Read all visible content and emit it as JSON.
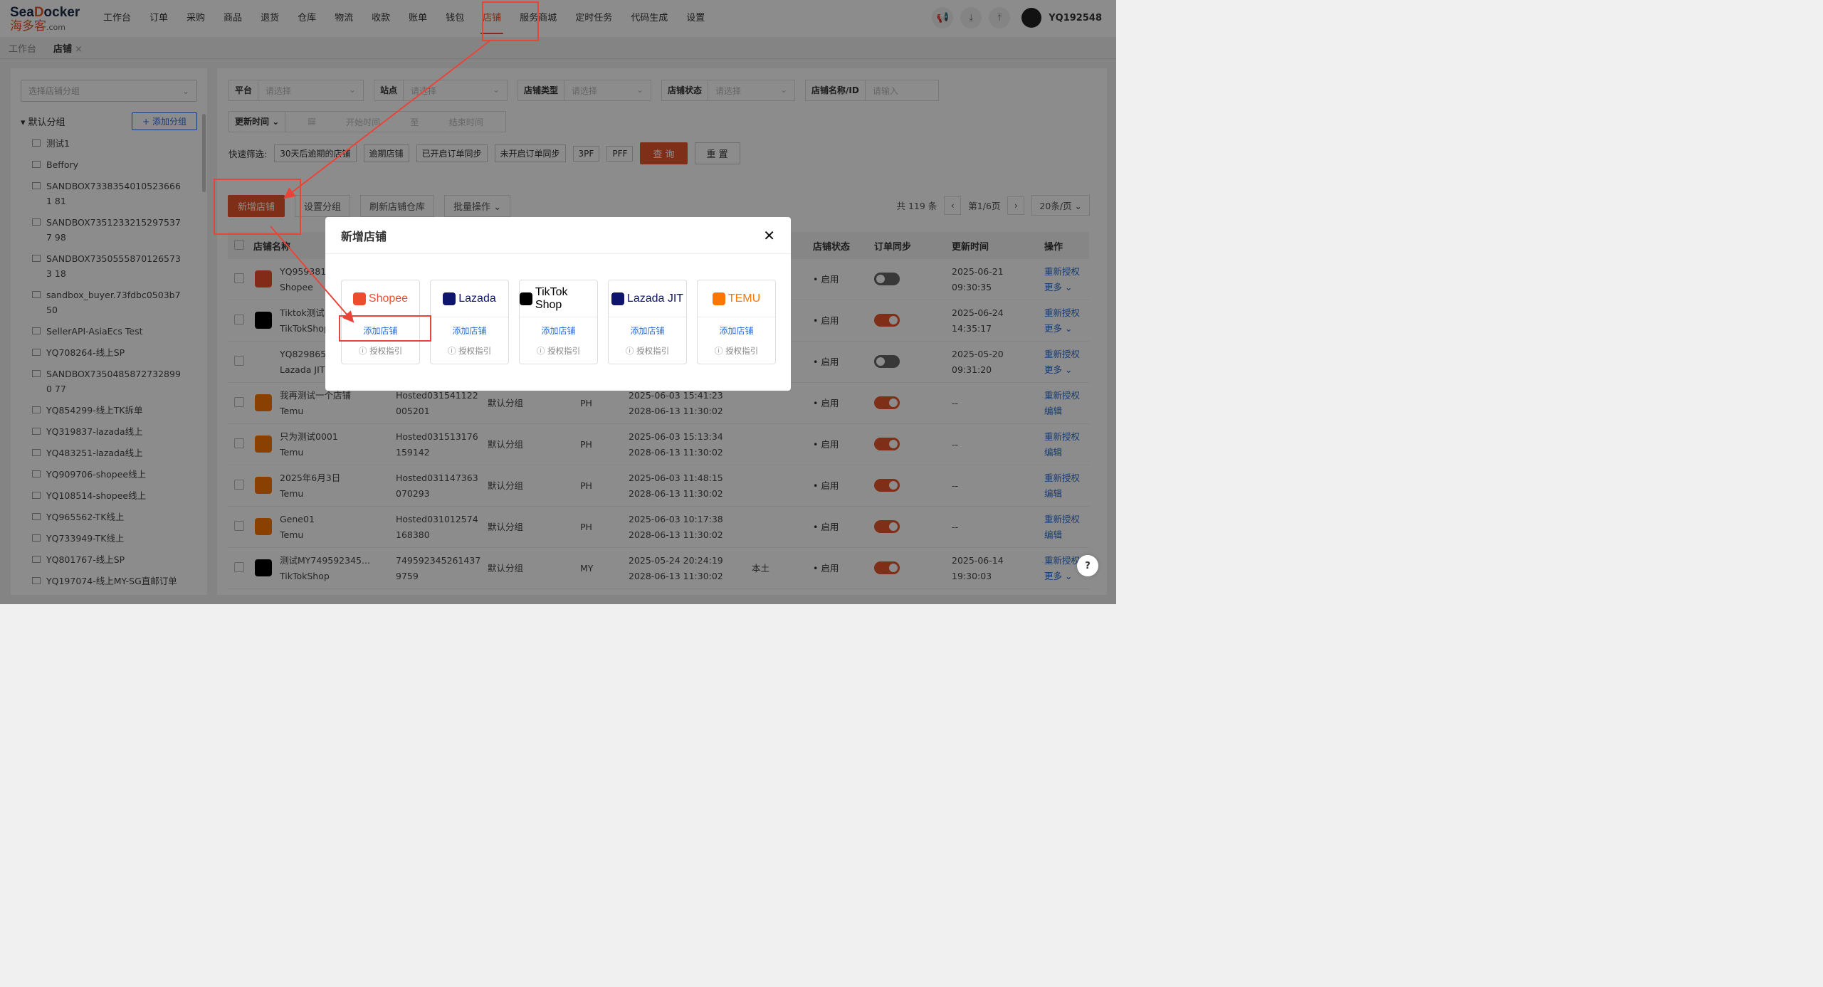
{
  "logo": {
    "en_a": "Sea",
    "en_b": "D",
    "en_c": "ocker",
    "cn": "海多客",
    "suffix": ".com"
  },
  "nav": [
    "工作台",
    "订单",
    "采购",
    "商品",
    "退货",
    "仓库",
    "物流",
    "收款",
    "账单",
    "钱包",
    "店铺",
    "服务商城",
    "定时任务",
    "代码生成",
    "设置"
  ],
  "nav_active": "店铺",
  "username": "YQ192548",
  "tabs": {
    "t1": "工作台",
    "t2": "店铺"
  },
  "sidebar": {
    "select": "选择店铺分组",
    "group": "默认分组",
    "add": "+ 添加分组",
    "items": [
      "测试1",
      "Beffory",
      "SANDBOX73383540105236661 81",
      "SANDBOX73512332152975377 98",
      "SANDBOX73505558701265733 18",
      "sandbox_buyer.73fdbc0503b750",
      "SellerAPI-AsiaEcs Test",
      "YQ708264-线上SP",
      "SANDBOX73504858727328990 77",
      "YQ854299-线上TK拆单",
      "YQ319837-lazada线上",
      "YQ483251-lazada线上",
      "YQ909706-shopee线上",
      "YQ108514-shopee线上",
      "YQ965562-TK线上",
      "YQ733949-TK线上",
      "YQ801767-线上SP",
      "YQ197074-线上MY-SG直邮订单"
    ]
  },
  "filters": {
    "platform": "平台",
    "site": "站点",
    "type": "店铺类型",
    "status": "店铺状态",
    "name": "店铺名称/ID",
    "ph": "请选择",
    "ph_in": "请输入",
    "time": "更新时间",
    "start": "开始时间",
    "to": "至",
    "end": "结束时间",
    "quick": "快速筛选:",
    "chips": [
      "30天后逾期的店铺",
      "逾期店铺",
      "已开启订单同步",
      "未开启订单同步",
      "3PF",
      "PFF"
    ],
    "query": "查 询",
    "reset": "重 置"
  },
  "actions": {
    "add": "新增店铺",
    "group": "设置分组",
    "refresh": "刷新店铺仓库",
    "batch": "批量操作"
  },
  "pager": {
    "total": "共 119 条",
    "page": "第1/6页",
    "size": "20条/页"
  },
  "thead": {
    "name": "店铺名称",
    "status": "店铺状态",
    "sync": "订单同步",
    "updated": "更新时间",
    "op": "操作"
  },
  "rows": [
    {
      "n1": "YQ959381-",
      "n2": "Shopee",
      "st": "启用",
      "sync": "off",
      "u1": "2025-06-21",
      "u2": "09:30:35",
      "o1": "重新授权",
      "o2": "更多 ⌄"
    },
    {
      "n1": "Tiktok测试(",
      "n2": "TikTokShop",
      "st": "启用",
      "sync": "on",
      "u1": "2025-06-24",
      "u2": "14:35:17",
      "o1": "重新授权",
      "o2": "更多 ⌄"
    },
    {
      "n1": "YQ829865-",
      "n2": "Lazada JIT",
      "st": "启用",
      "sync": "off",
      "u1": "2025-05-20",
      "u2": "09:31:20",
      "o1": "重新授权",
      "o2": "更多 ⌄"
    },
    {
      "n1": "我再测试一个店铺",
      "n2": "Temu",
      "id1": "Hosted031541122",
      "id2": "005201",
      "g": "默认分组",
      "site": "PH",
      "t1": "2025-06-03 15:41:23",
      "t2": "2028-06-13 11:30:02",
      "st": "启用",
      "sync": "on",
      "u1": "--",
      "o1": "重新授权",
      "o2": "编辑"
    },
    {
      "n1": "只为测试0001",
      "n2": "Temu",
      "id1": "Hosted031513176",
      "id2": "159142",
      "g": "默认分组",
      "site": "PH",
      "t1": "2025-06-03 15:13:34",
      "t2": "2028-06-13 11:30:02",
      "st": "启用",
      "sync": "on",
      "u1": "--",
      "o1": "重新授权",
      "o2": "编辑"
    },
    {
      "n1": "2025年6月3日",
      "n2": "Temu",
      "id1": "Hosted031147363",
      "id2": "070293",
      "g": "默认分组",
      "site": "PH",
      "t1": "2025-06-03 11:48:15",
      "t2": "2028-06-13 11:30:02",
      "st": "启用",
      "sync": "on",
      "u1": "--",
      "o1": "重新授权",
      "o2": "编辑"
    },
    {
      "n1": "Gene01",
      "n2": "Temu",
      "id1": "Hosted031012574",
      "id2": "168380",
      "g": "默认分组",
      "site": "PH",
      "t1": "2025-06-03 10:17:38",
      "t2": "2028-06-13 11:30:02",
      "st": "启用",
      "sync": "on",
      "u1": "--",
      "o1": "重新授权",
      "o2": "编辑"
    },
    {
      "n1": "测试MY749592345...",
      "n2": "TikTokShop",
      "id1": "749592345261437",
      "id2": "9759",
      "g": "默认分组",
      "site": "MY",
      "type": "本土",
      "t1": "2025-05-24 20:24:19",
      "t2": "2028-06-13 11:30:02",
      "st": "启用",
      "sync": "on",
      "u1": "2025-06-14",
      "u2": "19:30:03",
      "o1": "重新授权",
      "o2": "更多 ⌄"
    }
  ],
  "modal": {
    "title": "新增店铺",
    "close": "✕",
    "add": "添加店铺",
    "guide": "授权指引",
    "platforms": [
      {
        "name": "Shopee",
        "color": "#ee4d2d"
      },
      {
        "name": "Lazada",
        "color": "#0f146d"
      },
      {
        "name": "TikTok Shop",
        "color": "#000000"
      },
      {
        "name": "Lazada JIT",
        "color": "#0f146d"
      },
      {
        "name": "TEMU",
        "color": "#fb7701"
      }
    ]
  },
  "help": "?"
}
